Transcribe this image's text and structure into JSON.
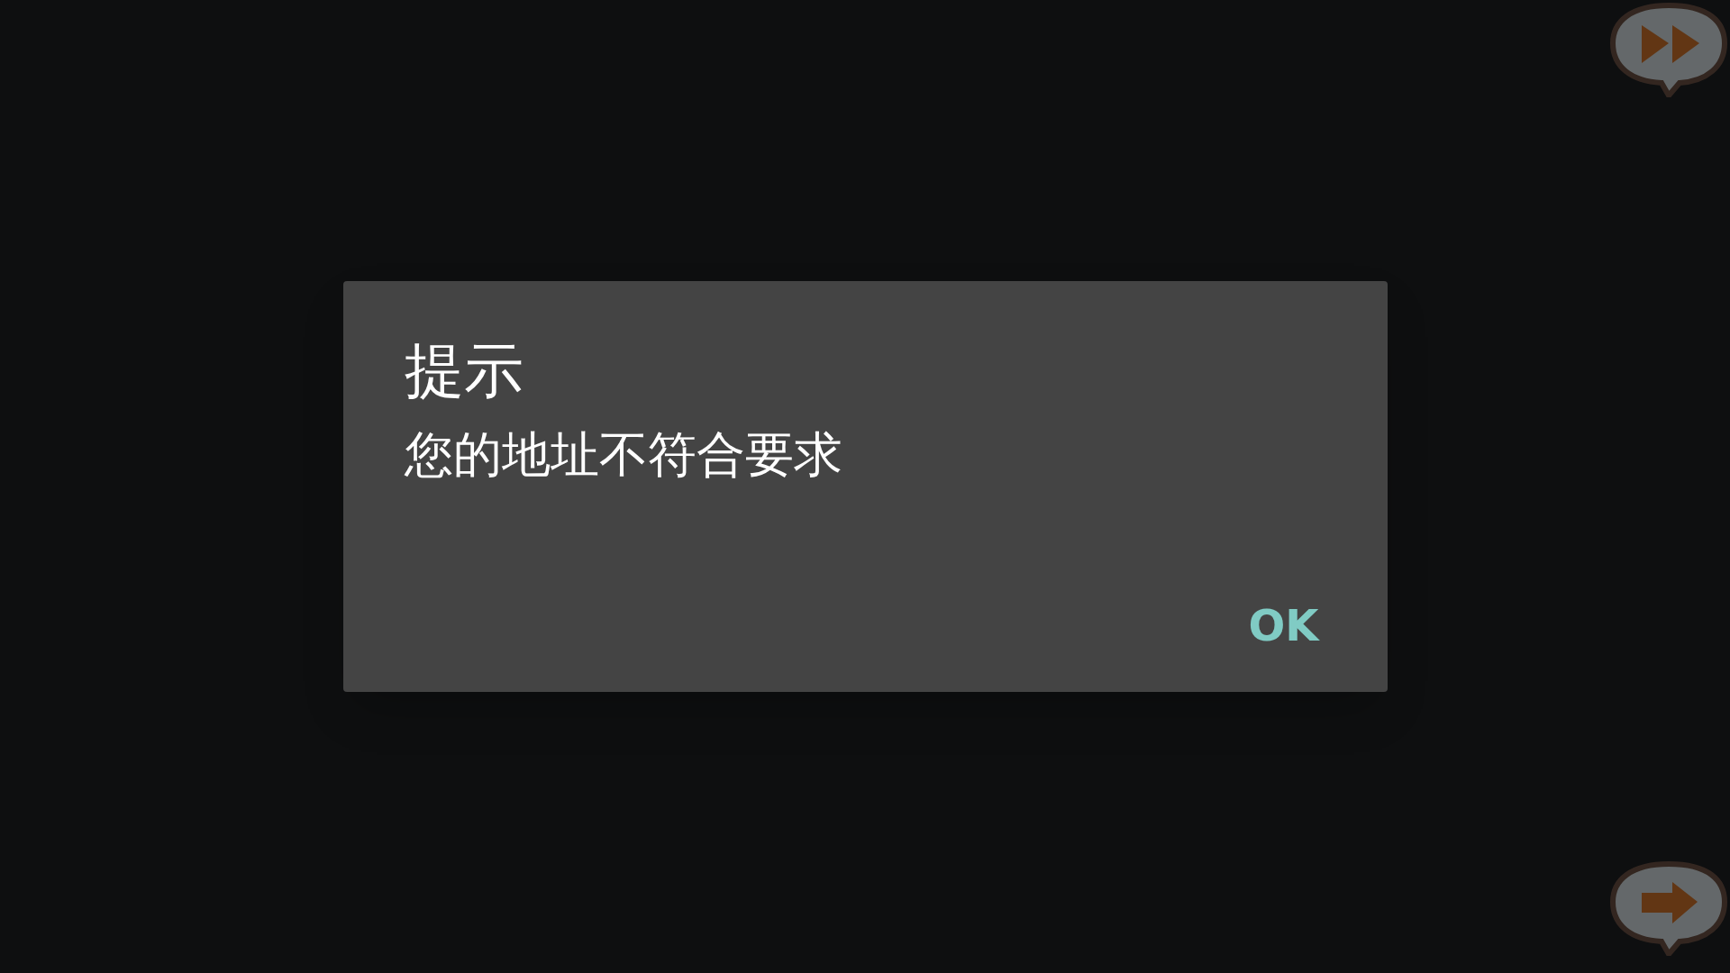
{
  "dialog": {
    "title": "提示",
    "message": "您的地址不符合要求",
    "buttons": [
      "OK"
    ]
  }
}
